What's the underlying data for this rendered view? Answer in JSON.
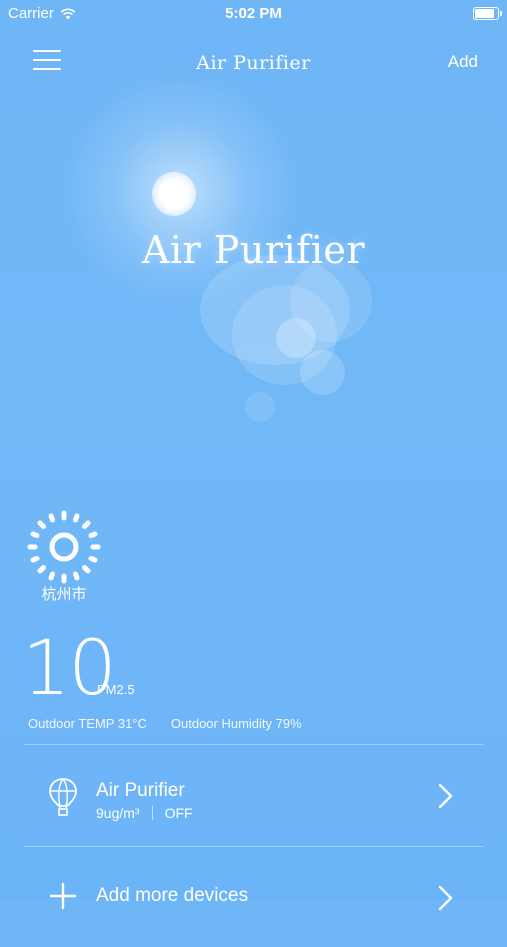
{
  "status_bar": {
    "carrier": "Carrier",
    "time": "5:02 PM",
    "battery_level": 1.0
  },
  "nav": {
    "title": "Air Purifier",
    "add_label": "Add"
  },
  "hero": {
    "title": "Air Purifier"
  },
  "weather": {
    "icon": "sun-icon",
    "city": "杭州市"
  },
  "air": {
    "pm_value": "10",
    "pm_unit": "PM2.5",
    "outdoor_temp": "Outdoor TEMP 31°C",
    "outdoor_humidity": "Outdoor Humidity 79%"
  },
  "devices": [
    {
      "name": "Air Purifier",
      "reading": "9ug/m³",
      "state": "OFF",
      "icon": "balloon-icon"
    }
  ],
  "add_more_label": "Add more devices"
}
